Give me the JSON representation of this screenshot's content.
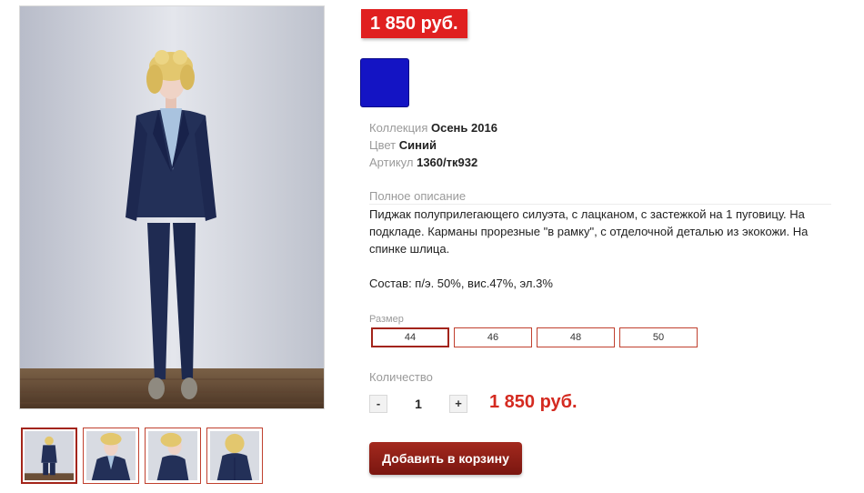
{
  "product": {
    "price_badge": "1 850 руб.",
    "color_swatch": "#1414c4",
    "meta": [
      {
        "label": "Коллекция",
        "value": "Осень 2016"
      },
      {
        "label": "Цвет",
        "value": "Синий"
      },
      {
        "label": "Артикул",
        "value": "1360/тк932"
      }
    ],
    "description_title": "Полное описание",
    "description": "Пиджак полуприлегающего силуэта, с лацканом, с застежкой на 1 пуговицу. На подкладе. Карманы прорезные \"в рамку\", с отделочной деталью из экокожи. На спинке шлица.",
    "composition": "Состав: п/э. 50%, вис.47%, эл.3%",
    "size_label": "Размер",
    "sizes": [
      "44",
      "46",
      "48",
      "50"
    ],
    "selected_size": "44",
    "quantity_label": "Количество",
    "qty_minus": "-",
    "qty_plus": "+",
    "quantity": "1",
    "total_price": "1 850 руб.",
    "add_to_cart": "Добавить в корзину"
  },
  "colors": {
    "price_red": "#e02020",
    "button_brown": "#8b1d14",
    "suit_navy": "#1e2a4f"
  }
}
